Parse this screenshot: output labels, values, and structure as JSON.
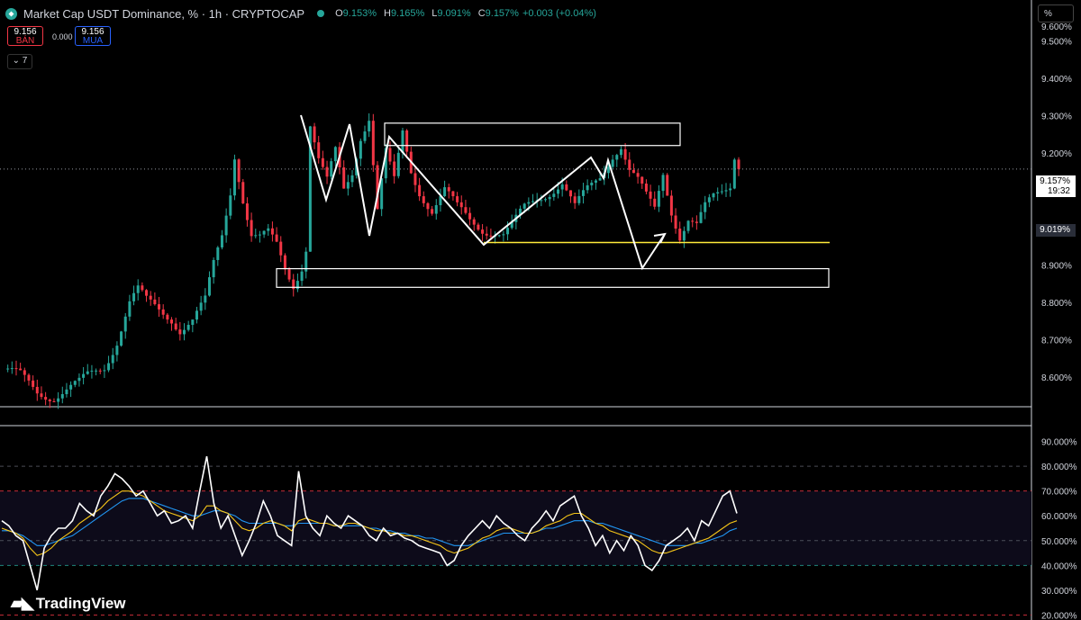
{
  "header": {
    "title": "Market Cap USDT Dominance, % · 1h · CRYPTOCAP",
    "ohlc": [
      {
        "key": "O",
        "value": "9.153%"
      },
      {
        "key": "H",
        "value": "9.165%"
      },
      {
        "key": "L",
        "value": "9.091%"
      },
      {
        "key": "C",
        "value": "9.157%"
      }
    ],
    "change": "+0.003 (+0.04%)"
  },
  "trade": {
    "sell_price": "9.156",
    "sell_label": "BÁN",
    "spread": "0.000",
    "buy_price": "9.156",
    "buy_label": "MUA"
  },
  "collapse_label": "⌄ 7",
  "scale_mode": "%",
  "brand": "TradingView",
  "colors": {
    "up": "#26a69a",
    "down": "#f23645",
    "background": "#000000",
    "rsi": "#ffffff",
    "rsi_ma_fast": "#f5c518",
    "rsi_ma_slow": "#2196f3",
    "support": "#ffeb3b",
    "annotation": "#ffffff"
  },
  "current_price": {
    "value": "9.157%",
    "countdown": "19:32"
  },
  "low_label": "9.019%",
  "price_axis": {
    "ticks": [
      "9.500%",
      "9.400%",
      "9.300%",
      "9.200%",
      "9.100%",
      "9.000%",
      "8.900%",
      "8.800%",
      "8.700%",
      "8.600%"
    ],
    "tick_values": [
      9.5,
      9.4,
      9.3,
      9.2,
      9.1,
      9.0,
      8.9,
      8.8,
      8.7,
      8.6
    ],
    "top_partial": "9.600%"
  },
  "rsi_axis": {
    "ticks": [
      "90.000%",
      "80.000%",
      "70.000%",
      "60.000%",
      "50.000%",
      "40.000%",
      "30.000%",
      "20.000%"
    ],
    "tick_values": [
      90,
      80,
      70,
      60,
      50,
      40,
      30,
      20
    ]
  },
  "chart_data": [
    {
      "type": "candlestick",
      "title": "Market Cap USDT Dominance, % · 1h · CRYPTOCAP",
      "ylim": [
        8.52,
        9.61
      ],
      "y_unit": "%",
      "close_path": [
        [
          0,
          8.62
        ],
        [
          4,
          8.6
        ],
        [
          8,
          8.56
        ],
        [
          12,
          8.55
        ],
        [
          16,
          8.57
        ],
        [
          18,
          8.58
        ],
        [
          20,
          8.6
        ],
        [
          24,
          8.63
        ],
        [
          27,
          8.7
        ],
        [
          30,
          8.8
        ],
        [
          32,
          8.83
        ],
        [
          34,
          8.8
        ],
        [
          37,
          8.78
        ],
        [
          40,
          8.76
        ],
        [
          42,
          8.73
        ],
        [
          45,
          8.75
        ],
        [
          48,
          8.8
        ],
        [
          50,
          8.9
        ],
        [
          52,
          8.98
        ],
        [
          54,
          9.1
        ],
        [
          55,
          9.2
        ],
        [
          57,
          9.08
        ],
        [
          59,
          8.98
        ],
        [
          61,
          8.97
        ],
        [
          63,
          8.98
        ],
        [
          65,
          8.95
        ],
        [
          67,
          8.89
        ],
        [
          69,
          8.85
        ],
        [
          71,
          8.9
        ],
        [
          72,
          8.95
        ],
        [
          73,
          9.28
        ],
        [
          75,
          9.18
        ],
        [
          77,
          9.12
        ],
        [
          79,
          9.2
        ],
        [
          81,
          9.1
        ],
        [
          83,
          9.15
        ],
        [
          85,
          9.25
        ],
        [
          87,
          9.3
        ],
        [
          89,
          9.05
        ],
        [
          91,
          9.2
        ],
        [
          93,
          9.12
        ],
        [
          95,
          9.25
        ],
        [
          97,
          9.15
        ],
        [
          99,
          9.1
        ],
        [
          102,
          9.05
        ],
        [
          105,
          9.1
        ],
        [
          108,
          9.05
        ],
        [
          111,
          9.02
        ],
        [
          114,
          9.0
        ],
        [
          117,
          8.99
        ],
        [
          119,
          8.98
        ],
        [
          121,
          9.0
        ],
        [
          124,
          9.05
        ],
        [
          127,
          9.08
        ],
        [
          130,
          9.1
        ],
        [
          133,
          9.12
        ],
        [
          136,
          9.05
        ],
        [
          139,
          9.1
        ],
        [
          142,
          9.14
        ],
        [
          145,
          9.2
        ],
        [
          147,
          9.22
        ],
        [
          149,
          9.15
        ],
        [
          151,
          9.12
        ],
        [
          153,
          9.08
        ],
        [
          155,
          9.05
        ],
        [
          157,
          9.15
        ],
        [
          159,
          9.05
        ],
        [
          161,
          8.98
        ],
        [
          163,
          9.02
        ],
        [
          165,
          9.0
        ],
        [
          167,
          9.05
        ],
        [
          169,
          9.08
        ],
        [
          171,
          9.1
        ],
        [
          173,
          9.12
        ],
        [
          174,
          9.2
        ],
        [
          175,
          9.16
        ]
      ],
      "last_price": 9.157,
      "session_low_marker": 9.019,
      "support_line": 8.96,
      "zones": [
        {
          "name": "resistance-box",
          "y": [
            9.22,
            9.28
          ]
        },
        {
          "name": "demand-box",
          "y": [
            8.84,
            8.89
          ]
        }
      ]
    },
    {
      "type": "line",
      "title": "RSI",
      "ylim": [
        18,
        96
      ],
      "y_unit": "%",
      "bands": {
        "upper": 70,
        "middle": 50,
        "lower": 40
      },
      "series": [
        {
          "values": [
            58,
            56,
            52,
            50,
            40,
            30,
            47,
            52,
            55,
            55,
            58,
            65,
            62,
            60,
            68,
            72,
            77,
            75,
            72,
            68,
            70,
            65,
            60,
            62,
            57,
            58,
            60,
            55,
            70,
            84,
            65,
            55,
            60,
            52,
            44,
            50,
            57,
            66,
            60,
            52,
            50,
            48,
            78,
            60,
            55,
            52,
            60,
            57,
            55,
            60,
            58,
            56,
            52,
            50,
            55,
            52,
            53,
            51,
            50,
            48,
            47,
            46,
            45,
            40,
            42,
            48,
            52,
            55,
            58,
            55,
            60,
            57,
            55,
            52,
            50,
            55,
            58,
            62,
            58,
            64,
            66,
            68,
            60,
            55,
            48,
            52,
            45,
            50,
            46,
            52,
            48,
            40,
            38,
            42,
            48,
            50,
            52,
            55,
            50,
            58,
            56,
            62,
            68,
            70,
            61
          ]
        },
        {
          "values": [
            55,
            54,
            53,
            51,
            47,
            44,
            45,
            47,
            50,
            52,
            54,
            57,
            59,
            61,
            63,
            66,
            68,
            70,
            70,
            69,
            68,
            66,
            64,
            62,
            61,
            60,
            59,
            58,
            60,
            64,
            64,
            62,
            61,
            58,
            55,
            54,
            55,
            57,
            58,
            57,
            56,
            54,
            58,
            59,
            58,
            57,
            57,
            56,
            56,
            57,
            57,
            56,
            55,
            54,
            54,
            53,
            53,
            52,
            52,
            51,
            50,
            49,
            48,
            46,
            45,
            46,
            47,
            49,
            51,
            52,
            54,
            55,
            55,
            54,
            53,
            53,
            54,
            56,
            57,
            58,
            60,
            61,
            61,
            59,
            57,
            56,
            54,
            53,
            52,
            51,
            50,
            48,
            46,
            45,
            45,
            46,
            47,
            48,
            49,
            50,
            51,
            53,
            55,
            57,
            58
          ]
        },
        {
          "values": [
            54,
            54,
            53,
            52,
            50,
            48,
            48,
            49,
            50,
            51,
            52,
            54,
            56,
            58,
            60,
            62,
            64,
            66,
            67,
            67,
            67,
            66,
            65,
            64,
            63,
            62,
            61,
            60,
            60,
            61,
            62,
            62,
            61,
            60,
            58,
            57,
            57,
            57,
            57,
            57,
            56,
            56,
            57,
            57,
            57,
            57,
            57,
            56,
            56,
            56,
            56,
            56,
            55,
            55,
            54,
            54,
            53,
            53,
            52,
            52,
            51,
            51,
            50,
            49,
            48,
            48,
            48,
            49,
            50,
            51,
            52,
            53,
            53,
            53,
            53,
            53,
            54,
            55,
            55,
            56,
            57,
            58,
            58,
            58,
            57,
            57,
            56,
            55,
            54,
            53,
            52,
            51,
            50,
            49,
            48,
            48,
            48,
            48,
            49,
            49,
            50,
            51,
            52,
            54,
            55
          ]
        }
      ]
    }
  ]
}
